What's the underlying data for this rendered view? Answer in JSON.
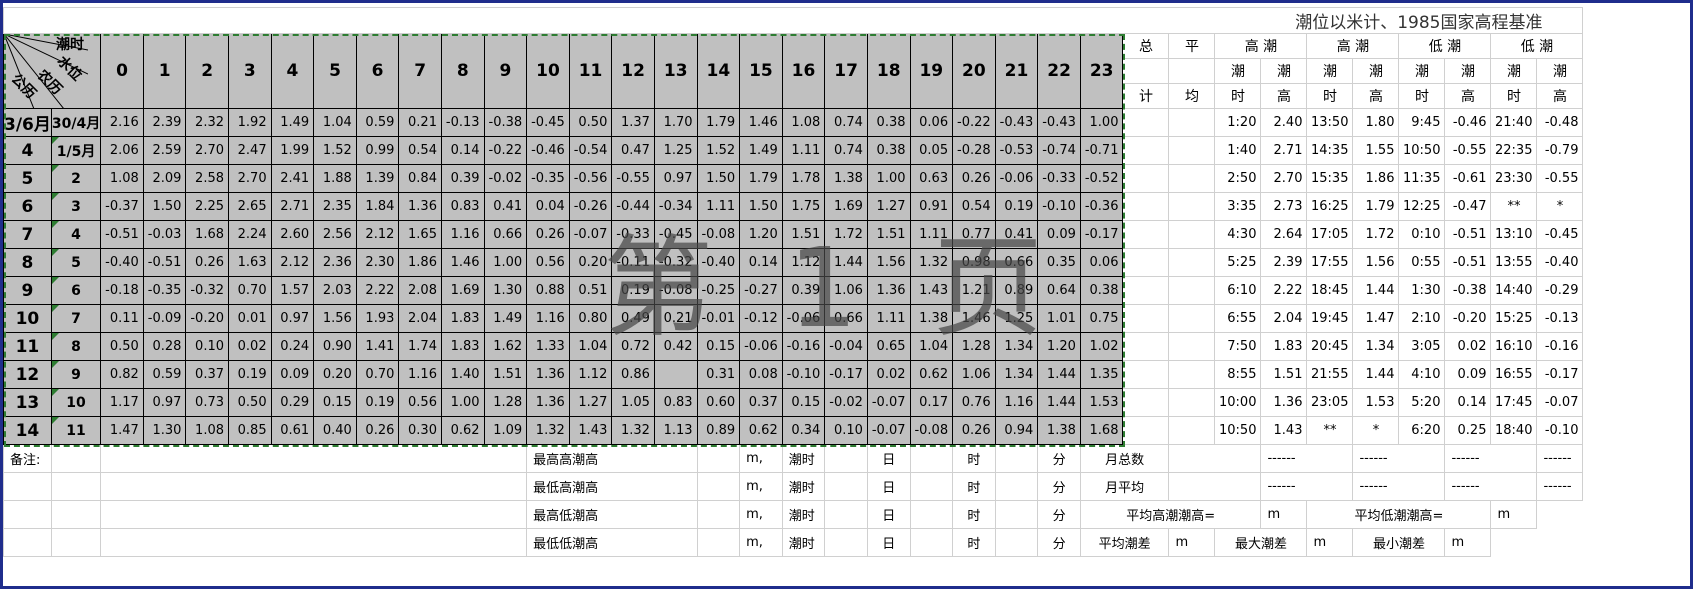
{
  "title": "潮位以米计、1985国家高程基准",
  "corner": {
    "tide_hour": "潮时",
    "water_level": "水位",
    "lunar": "农历",
    "solar": "公历"
  },
  "hours": [
    "0",
    "1",
    "2",
    "3",
    "4",
    "5",
    "6",
    "7",
    "8",
    "9",
    "10",
    "11",
    "12",
    "13",
    "14",
    "15",
    "16",
    "17",
    "18",
    "19",
    "20",
    "21",
    "22",
    "23"
  ],
  "right_header": {
    "total": [
      "总",
      "计"
    ],
    "avg": [
      "平",
      "均"
    ],
    "groups": [
      "高 潮",
      "高 潮",
      "低 潮",
      "低 潮"
    ],
    "sub_top": [
      "潮",
      "潮",
      "潮",
      "潮",
      "潮",
      "潮",
      "潮",
      "潮"
    ],
    "sub_bottom": [
      "时",
      "高",
      "时",
      "高",
      "时",
      "高",
      "时",
      "高"
    ]
  },
  "rows": [
    {
      "solar": "3/6月",
      "lunar": "30/4月",
      "values": [
        "2.16",
        "2.39",
        "2.32",
        "1.92",
        "1.49",
        "1.04",
        "0.59",
        "0.21",
        "-0.13",
        "-0.38",
        "-0.45",
        "0.50",
        "1.37",
        "1.70",
        "1.79",
        "1.46",
        "1.08",
        "0.74",
        "0.38",
        "0.06",
        "-0.22",
        "-0.43",
        "-0.43",
        "1.00"
      ],
      "tides": [
        "1:20",
        "2.40",
        "13:50",
        "1.80",
        "9:45",
        "-0.46",
        "21:40",
        "-0.48"
      ]
    },
    {
      "solar": "4",
      "lunar": "1/5月",
      "values": [
        "2.06",
        "2.59",
        "2.70",
        "2.47",
        "1.99",
        "1.52",
        "0.99",
        "0.54",
        "0.14",
        "-0.22",
        "-0.46",
        "-0.54",
        "0.47",
        "1.25",
        "1.52",
        "1.49",
        "1.11",
        "0.74",
        "0.38",
        "0.05",
        "-0.28",
        "-0.53",
        "-0.74",
        "-0.71"
      ],
      "tides": [
        "1:40",
        "2.71",
        "14:35",
        "1.55",
        "10:50",
        "-0.55",
        "22:35",
        "-0.79"
      ]
    },
    {
      "solar": "5",
      "lunar": "2",
      "values": [
        "1.08",
        "2.09",
        "2.58",
        "2.70",
        "2.41",
        "1.88",
        "1.39",
        "0.84",
        "0.39",
        "-0.02",
        "-0.35",
        "-0.56",
        "-0.55",
        "0.97",
        "1.50",
        "1.79",
        "1.78",
        "1.38",
        "1.00",
        "0.63",
        "0.26",
        "-0.06",
        "-0.33",
        "-0.52"
      ],
      "tides": [
        "2:50",
        "2.70",
        "15:35",
        "1.86",
        "11:35",
        "-0.61",
        "23:30",
        "-0.55"
      ]
    },
    {
      "solar": "6",
      "lunar": "3",
      "values": [
        "-0.37",
        "1.50",
        "2.25",
        "2.65",
        "2.71",
        "2.35",
        "1.84",
        "1.36",
        "0.83",
        "0.41",
        "0.04",
        "-0.26",
        "-0.44",
        "-0.34",
        "1.11",
        "1.50",
        "1.75",
        "1.69",
        "1.27",
        "0.91",
        "0.54",
        "0.19",
        "-0.10",
        "-0.36"
      ],
      "tides": [
        "3:35",
        "2.73",
        "16:25",
        "1.79",
        "12:25",
        "-0.47",
        "**",
        "*"
      ]
    },
    {
      "solar": "7",
      "lunar": "4",
      "values": [
        "-0.51",
        "-0.03",
        "1.68",
        "2.24",
        "2.60",
        "2.56",
        "2.12",
        "1.65",
        "1.16",
        "0.66",
        "0.26",
        "-0.07",
        "-0.33",
        "-0.45",
        "-0.08",
        "1.20",
        "1.51",
        "1.72",
        "1.51",
        "1.11",
        "0.77",
        "0.41",
        "0.09",
        "-0.17"
      ],
      "tides": [
        "4:30",
        "2.64",
        "17:05",
        "1.72",
        "0:10",
        "-0.51",
        "13:10",
        "-0.45"
      ]
    },
    {
      "solar": "8",
      "lunar": "5",
      "values": [
        "-0.40",
        "-0.51",
        "0.26",
        "1.63",
        "2.12",
        "2.36",
        "2.30",
        "1.86",
        "1.46",
        "1.00",
        "0.56",
        "0.20",
        "-0.11",
        "-0.32",
        "-0.40",
        "0.14",
        "1.12",
        "1.44",
        "1.56",
        "1.32",
        "0.98",
        "0.66",
        "0.35",
        "0.06"
      ],
      "tides": [
        "5:25",
        "2.39",
        "17:55",
        "1.56",
        "0:55",
        "-0.51",
        "13:55",
        "-0.40"
      ]
    },
    {
      "solar": "9",
      "lunar": "6",
      "values": [
        "-0.18",
        "-0.35",
        "-0.32",
        "0.70",
        "1.57",
        "2.03",
        "2.22",
        "2.08",
        "1.69",
        "1.30",
        "0.88",
        "0.51",
        "0.19",
        "-0.08",
        "-0.25",
        "-0.27",
        "0.39",
        "1.06",
        "1.36",
        "1.43",
        "1.21",
        "0.89",
        "0.64",
        "0.38"
      ],
      "tides": [
        "6:10",
        "2.22",
        "18:45",
        "1.44",
        "1:30",
        "-0.38",
        "14:40",
        "-0.29"
      ]
    },
    {
      "solar": "10",
      "lunar": "7",
      "values": [
        "0.11",
        "-0.09",
        "-0.20",
        "0.01",
        "0.97",
        "1.56",
        "1.93",
        "2.04",
        "1.83",
        "1.49",
        "1.16",
        "0.80",
        "0.49",
        "0.21",
        "-0.01",
        "-0.12",
        "-0.06",
        "0.66",
        "1.11",
        "1.38",
        "1.46",
        "1.25",
        "1.01",
        "0.75"
      ],
      "tides": [
        "6:55",
        "2.04",
        "19:45",
        "1.47",
        "2:10",
        "-0.20",
        "15:25",
        "-0.13"
      ]
    },
    {
      "solar": "11",
      "lunar": "8",
      "values": [
        "0.50",
        "0.28",
        "0.10",
        "0.02",
        "0.24",
        "0.90",
        "1.41",
        "1.74",
        "1.83",
        "1.62",
        "1.33",
        "1.04",
        "0.72",
        "0.42",
        "0.15",
        "-0.06",
        "-0.16",
        "-0.04",
        "0.65",
        "1.04",
        "1.28",
        "1.34",
        "1.20",
        "1.02"
      ],
      "tides": [
        "7:50",
        "1.83",
        "20:45",
        "1.34",
        "3:05",
        "0.02",
        "16:10",
        "-0.16"
      ]
    },
    {
      "solar": "12",
      "lunar": "9",
      "values": [
        "0.82",
        "0.59",
        "0.37",
        "0.19",
        "0.09",
        "0.20",
        "0.70",
        "1.16",
        "1.40",
        "1.51",
        "1.36",
        "1.12",
        "0.86",
        "",
        "0.31",
        "0.08",
        "-0.10",
        "-0.17",
        "0.02",
        "0.62",
        "1.06",
        "1.34",
        "1.44",
        "1.35"
      ],
      "tides": [
        "8:55",
        "1.51",
        "21:55",
        "1.44",
        "4:10",
        "0.09",
        "16:55",
        "-0.17"
      ]
    },
    {
      "solar": "13",
      "lunar": "10",
      "values": [
        "1.17",
        "0.97",
        "0.73",
        "0.50",
        "0.29",
        "0.15",
        "0.19",
        "0.56",
        "1.00",
        "1.28",
        "1.36",
        "1.27",
        "1.05",
        "0.83",
        "0.60",
        "0.37",
        "0.15",
        "-0.02",
        "-0.07",
        "0.17",
        "0.76",
        "1.16",
        "1.44",
        "1.53"
      ],
      "tides": [
        "10:00",
        "1.36",
        "23:05",
        "1.53",
        "5:20",
        "0.14",
        "17:45",
        "-0.07"
      ]
    },
    {
      "solar": "14",
      "lunar": "11",
      "values": [
        "1.47",
        "1.30",
        "1.08",
        "0.85",
        "0.61",
        "0.40",
        "0.26",
        "0.30",
        "0.62",
        "1.09",
        "1.32",
        "1.43",
        "1.32",
        "1.13",
        "0.89",
        "0.62",
        "0.34",
        "0.10",
        "-0.07",
        "-0.08",
        "0.26",
        "0.94",
        "1.38",
        "1.68"
      ],
      "tides": [
        "10:50",
        "1.43",
        "**",
        "*",
        "6:20",
        "0.25",
        "18:40",
        "-0.10"
      ]
    }
  ],
  "footer": {
    "remark": "备注:",
    "rows": [
      {
        "label": "最高高潮高",
        "m": "m,",
        "tide_time": "潮时",
        "day": "日",
        "hour": "时",
        "minute": "分",
        "extra": "月总数",
        "dashes": [
          "------",
          "------",
          "------",
          "------"
        ]
      },
      {
        "label": "最低高潮高",
        "m": "m,",
        "tide_time": "潮时",
        "day": "日",
        "hour": "时",
        "minute": "分",
        "extra": "月平均",
        "dashes": [
          "------",
          "------",
          "------",
          "------"
        ]
      },
      {
        "label": "最高低潮高",
        "m": "m,",
        "tide_time": "潮时",
        "day": "日",
        "hour": "时",
        "minute": "分",
        "avg_high": "平均高潮潮高=",
        "m1": "m",
        "avg_low": "平均低潮潮高=",
        "m2": "m"
      },
      {
        "label": "最低低潮高",
        "m": "m,",
        "tide_time": "潮时",
        "day": "日",
        "hour": "时",
        "minute": "分",
        "avg_range": "平均潮差",
        "m1": "m",
        "max_range": "最大潮差",
        "m2": "m",
        "min_range": "最小潮差",
        "m3": "m"
      }
    ]
  },
  "watermark": "第 1 页",
  "colors": {
    "grid_fill": "#c0c0c0",
    "dash_border": "#2e7d32",
    "frame": "#1f2d8c"
  }
}
